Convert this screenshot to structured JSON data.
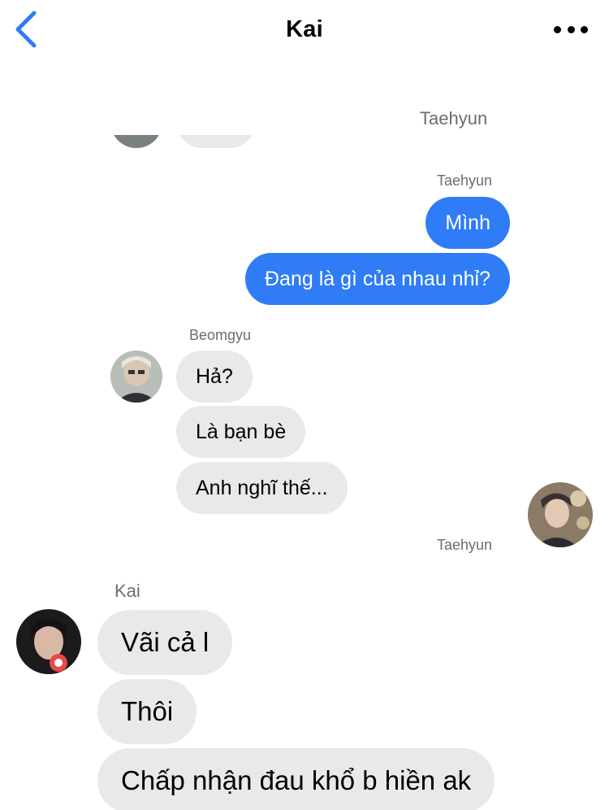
{
  "header": {
    "title": "Kai",
    "back_icon": "chevron-left-icon",
    "more_icon": "more-horizontal-icon",
    "accent_color": "#2f7cf6"
  },
  "messages": {
    "top_sender": "Taehyun",
    "outgoing_sender": "Taehyun",
    "outgoing": [
      "Mình",
      "Đang là gì của nhau nhỉ?"
    ],
    "beomgyu_sender": "Beomgyu",
    "beomgyu": [
      "Hả?",
      "Là bạn bè",
      "Anh nghĩ thế..."
    ],
    "taehyun_label": "Taehyun",
    "kai_sender": "Kai",
    "kai": [
      "Vãi cả l",
      "Thôi",
      "Chấp nhận đau khổ b hiền ak"
    ]
  },
  "colors": {
    "incoming_bubble": "#e9e9eb",
    "outgoing_bubble": "#2f7cf6",
    "sender_name": "#6d6d72"
  }
}
